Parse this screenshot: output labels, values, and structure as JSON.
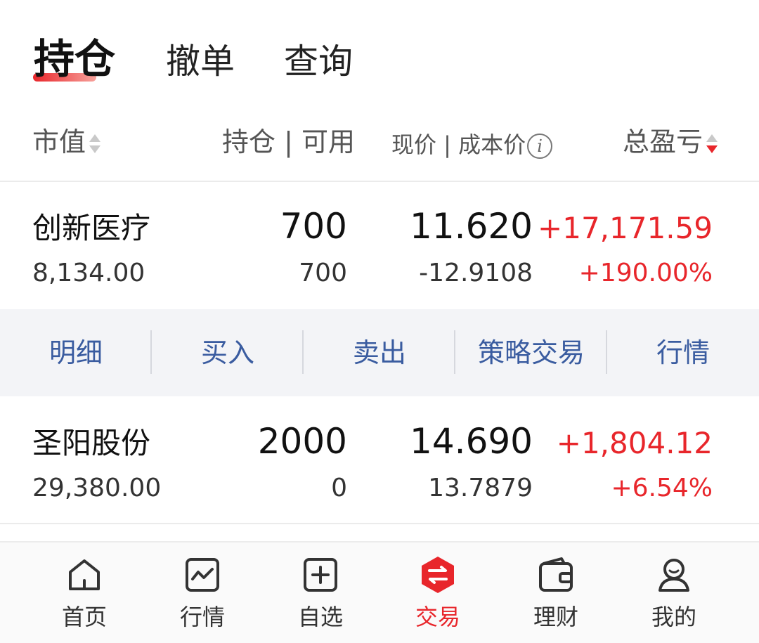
{
  "tabs": [
    {
      "label": "持仓",
      "active": true
    },
    {
      "label": "撤单",
      "active": false
    },
    {
      "label": "查询",
      "active": false
    }
  ],
  "header": {
    "market_value": "市值",
    "position": "持仓 | 可用",
    "price": "现价 | 成本价",
    "info_icon_glyph": "i",
    "profit_loss": "总盈亏"
  },
  "holdings": [
    {
      "name": "创新医疗",
      "market_value": "8,134.00",
      "position": "700",
      "available": "700",
      "price": "11.620",
      "cost": "-12.9108",
      "profit_loss": "+17,171.59",
      "profit_loss_pct": "+190.00%"
    },
    {
      "name": "圣阳股份",
      "market_value": "29,380.00",
      "position": "2000",
      "available": "0",
      "price": "14.690",
      "cost": "13.7879",
      "profit_loss": "+1,804.12",
      "profit_loss_pct": "+6.54%"
    }
  ],
  "actions": [
    {
      "label": "明细"
    },
    {
      "label": "买入"
    },
    {
      "label": "卖出"
    },
    {
      "label": "策略交易"
    },
    {
      "label": "行情"
    }
  ],
  "bottom_nav": [
    {
      "label": "首页",
      "icon": "home-icon",
      "active": false
    },
    {
      "label": "行情",
      "icon": "chart-icon",
      "active": false
    },
    {
      "label": "自选",
      "icon": "add-square-icon",
      "active": false
    },
    {
      "label": "交易",
      "icon": "exchange-icon",
      "active": true
    },
    {
      "label": "理财",
      "icon": "wallet-icon",
      "active": false
    },
    {
      "label": "我的",
      "icon": "user-icon",
      "active": false
    }
  ],
  "colors": {
    "accent_red": "#e8262b",
    "action_blue": "#3a5ca0",
    "action_bar_bg": "#f3f4f7"
  }
}
